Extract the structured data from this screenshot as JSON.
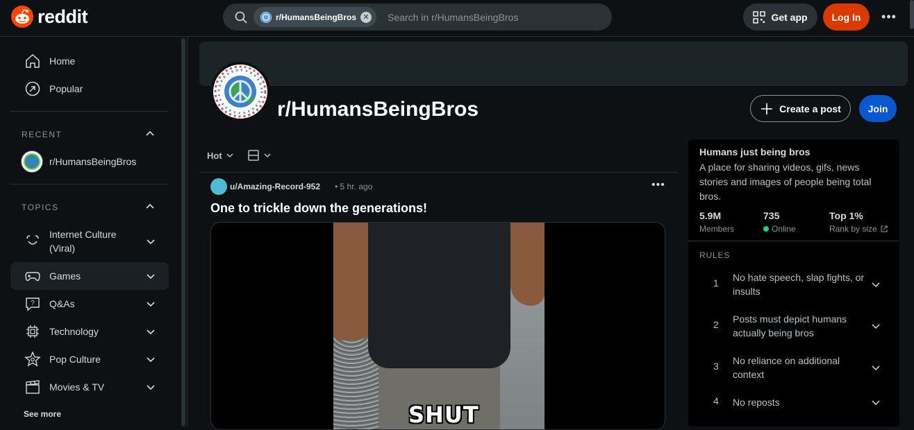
{
  "header": {
    "logo_text": "reddit",
    "search_chip": "r/HumansBeingBros",
    "search_placeholder": "Search in r/HumansBeingBros",
    "get_app": "Get app",
    "login": "Log In"
  },
  "sidebar": {
    "home": "Home",
    "popular": "Popular",
    "recent_heading": "RECENT",
    "recent_item": "r/HumansBeingBros",
    "topics_heading": "TOPICS",
    "topics": [
      {
        "label": "Internet Culture",
        "label2": "(Viral)"
      },
      {
        "label": "Games"
      },
      {
        "label": "Q&As"
      },
      {
        "label": "Technology"
      },
      {
        "label": "Pop Culture"
      },
      {
        "label": "Movies & TV"
      }
    ],
    "see_more": "See more"
  },
  "subreddit": {
    "name": "r/HumansBeingBros",
    "create_post": "Create a post",
    "join": "Join"
  },
  "feed": {
    "sort": "Hot",
    "post": {
      "author": "u/Amazing-Record-952",
      "time": "• 5 hr. ago",
      "title": "One to trickle down the generations!",
      "caption": "SHUT"
    }
  },
  "about": {
    "title": "Humans just being bros",
    "description": "A place for sharing videos, gifs, news stories and images of people being total bros.",
    "stats": [
      {
        "value": "5.9M",
        "label": "Members"
      },
      {
        "value": "735",
        "label": "Online"
      },
      {
        "value": "Top 1%",
        "label": "Rank by size"
      }
    ],
    "rules_heading": "RULES",
    "rules": [
      {
        "num": "1",
        "text": "No hate speech, slap fights, or insults"
      },
      {
        "num": "2",
        "text": "Posts must depict humans actually being bros"
      },
      {
        "num": "3",
        "text": "No reliance on additional context"
      },
      {
        "num": "4",
        "text": "No reposts"
      }
    ]
  },
  "colors": {
    "background": "#0e1113",
    "login": "#d93a00",
    "join": "#0a58d0",
    "online": "#0fd47a",
    "reddit_orange": "#ff4500"
  },
  "icons": [
    "snoo-logo-icon",
    "search-icon",
    "close-icon",
    "qr-code-icon",
    "more-icon",
    "home-icon",
    "popular-icon",
    "chevron-up-icon",
    "chevron-down-icon",
    "smile-icon",
    "gamepad-icon",
    "question-icon",
    "chip-icon",
    "star-icon",
    "clapper-icon",
    "plus-icon",
    "layout-icon",
    "external-link-icon"
  ]
}
